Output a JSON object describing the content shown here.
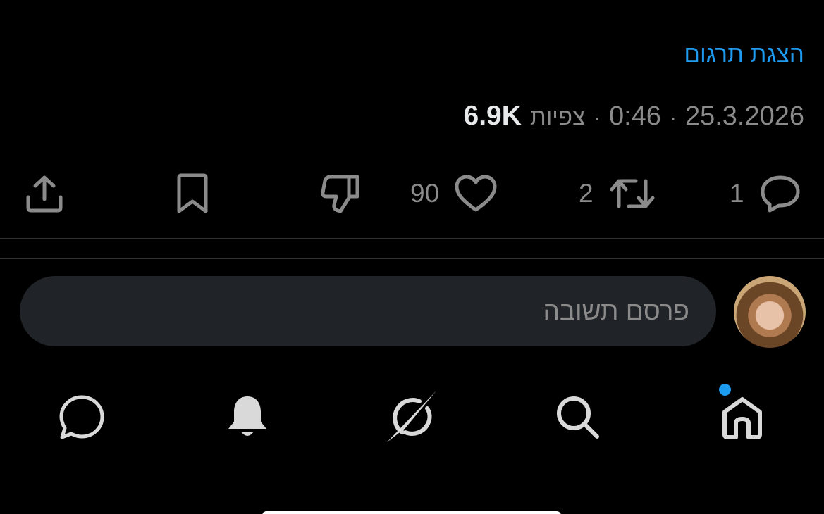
{
  "post": {
    "translate_label": "הצגת תרגום",
    "date": "25.3.2026",
    "time": "0:46",
    "separator": "·",
    "views_count": "6.9K",
    "views_label": "צפיות"
  },
  "actions": {
    "reply_count": "1",
    "repost_count": "2",
    "like_count": "90"
  },
  "reply": {
    "placeholder": "פרסם תשובה"
  },
  "tabbar": {
    "items": [
      "home-icon",
      "search-icon",
      "grok-icon",
      "bell-icon",
      "messages-icon"
    ],
    "home_has_notification": true
  },
  "colors": {
    "accent": "#1d9bf0",
    "background": "#000000",
    "icon_gray": "#8b8b8b",
    "tab_icon": "#d9d9d9",
    "input_bg": "#202327"
  }
}
